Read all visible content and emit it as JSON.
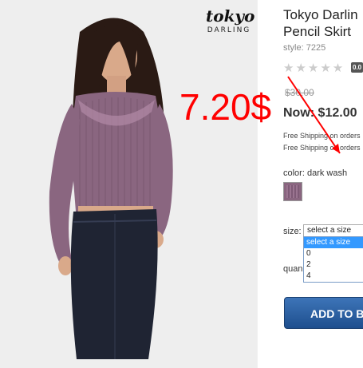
{
  "product": {
    "brand_top": "tokyo",
    "brand_bottom": "DARLING",
    "title_line1": "Tokyo Darlin",
    "title_line2": "Pencil Skirt",
    "style": "style: 7225",
    "rating_badge": "0.0",
    "stars": "★★★★★",
    "was_price": "$30.00",
    "now_price": "Now: $12.00",
    "shipping_line1": "Free Shipping on orders",
    "shipping_line2": "Free Shipping on orders",
    "color_label": "color: dark wash"
  },
  "size": {
    "label": "size:",
    "selected": "select a size",
    "options": [
      "select a size",
      "0",
      "2",
      "4"
    ]
  },
  "quantity": {
    "label": "quan"
  },
  "cart": {
    "add_label": "ADD TO BA"
  },
  "annotation": {
    "text": "7.20$"
  },
  "colors": {
    "accent": "#1e4f8e",
    "annotation": "#ff0000",
    "sweater": "#8a6680",
    "skirt": "#1f2433"
  }
}
